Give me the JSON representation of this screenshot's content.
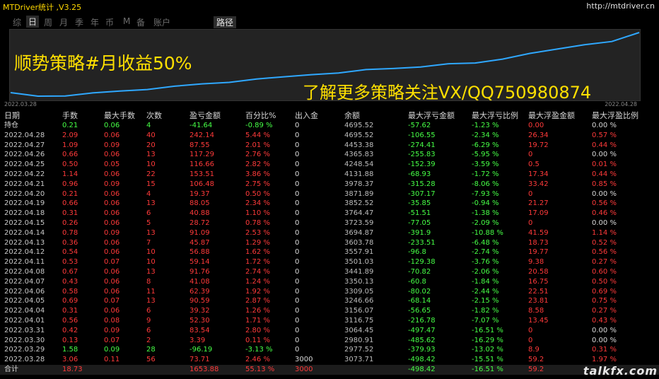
{
  "header": {
    "title": "MTDriver统计 ,V3.25",
    "url": "http://mtdriver.cn"
  },
  "tabs": [
    "综",
    "日",
    "周",
    "月",
    "季",
    "年",
    "币",
    "M",
    "备",
    "账户",
    "路径"
  ],
  "active_tab": "日",
  "chart": {
    "start_date": "2022.03.28",
    "end_date": "2022.04.28",
    "line_color": "#2fa8ff",
    "overlay_text_1": "顺势策略#月收益50%",
    "overlay_text_2": "了解更多策略关注VX/QQ750980874"
  },
  "chart_data": {
    "type": "line",
    "x": [
      "2022.03.28",
      "2022.03.29",
      "2022.03.30",
      "2022.03.31",
      "2022.04.01",
      "2022.04.04",
      "2022.04.05",
      "2022.04.06",
      "2022.04.07",
      "2022.04.08",
      "2022.04.11",
      "2022.04.12",
      "2022.04.13",
      "2022.04.14",
      "2022.04.15",
      "2022.04.18",
      "2022.04.19",
      "2022.04.20",
      "2022.04.21",
      "2022.04.22",
      "2022.04.25",
      "2022.04.26",
      "2022.04.27",
      "2022.04.28"
    ],
    "values": [
      3073.71,
      2977.52,
      2980.91,
      3064.45,
      3116.75,
      3156.07,
      3246.66,
      3309.05,
      3350.13,
      3441.89,
      3501.03,
      3557.91,
      3603.78,
      3694.87,
      3723.59,
      3764.47,
      3852.52,
      3871.89,
      3978.37,
      4131.88,
      4248.54,
      4365.83,
      4453.38,
      4695.52
    ]
  },
  "table": {
    "columns": [
      "日期",
      "手数",
      "最大手数",
      "次数",
      "盈亏金额",
      "百分比%",
      "出入金",
      "余额",
      "最大浮亏金额",
      "最大浮亏比例",
      "最大浮盈金额",
      "最大浮盈比例"
    ],
    "rows": [
      [
        "持仓",
        "0.21",
        "0.06",
        "4",
        "-41.64",
        "-0.89 %",
        "0",
        "4695.52",
        "-57.62",
        "-1.23 %",
        "0.00",
        "0.00 %"
      ],
      [
        "2022.04.28",
        "2.09",
        "0.06",
        "40",
        "242.14",
        "5.44 %",
        "0",
        "4695.52",
        "-106.55",
        "-2.34 %",
        "26.34",
        "0.57 %"
      ],
      [
        "2022.04.27",
        "1.09",
        "0.09",
        "20",
        "87.55",
        "2.01 %",
        "0",
        "4453.38",
        "-274.41",
        "-6.29 %",
        "19.72",
        "0.44 %"
      ],
      [
        "2022.04.26",
        "0.66",
        "0.06",
        "13",
        "117.29",
        "2.76 %",
        "0",
        "4365.83",
        "-255.83",
        "-5.95 %",
        "0",
        "0.00 %"
      ],
      [
        "2022.04.25",
        "0.50",
        "0.05",
        "10",
        "116.66",
        "2.82 %",
        "0",
        "4248.54",
        "-152.39",
        "-3.59 %",
        "0.5",
        "0.01 %"
      ],
      [
        "2022.04.22",
        "1.14",
        "0.06",
        "22",
        "153.51",
        "3.86 %",
        "0",
        "4131.88",
        "-68.93",
        "-1.72 %",
        "17.34",
        "0.44 %"
      ],
      [
        "2022.04.21",
        "0.96",
        "0.09",
        "15",
        "106.48",
        "2.75 %",
        "0",
        "3978.37",
        "-315.28",
        "-8.06 %",
        "33.42",
        "0.85 %"
      ],
      [
        "2022.04.20",
        "0.21",
        "0.06",
        "4",
        "19.37",
        "0.50 %",
        "0",
        "3871.89",
        "-307.17",
        "-7.93 %",
        "0",
        "0.00 %"
      ],
      [
        "2022.04.19",
        "0.66",
        "0.06",
        "13",
        "88.05",
        "2.34 %",
        "0",
        "3852.52",
        "-35.85",
        "-0.94 %",
        "21.27",
        "0.56 %"
      ],
      [
        "2022.04.18",
        "0.31",
        "0.06",
        "6",
        "40.88",
        "1.10 %",
        "0",
        "3764.47",
        "-51.51",
        "-1.38 %",
        "17.09",
        "0.46 %"
      ],
      [
        "2022.04.15",
        "0.26",
        "0.06",
        "5",
        "28.72",
        "0.78 %",
        "0",
        "3723.59",
        "-77.05",
        "-2.09 %",
        "0",
        "0.00 %"
      ],
      [
        "2022.04.14",
        "0.78",
        "0.09",
        "13",
        "91.09",
        "2.53 %",
        "0",
        "3694.87",
        "-391.9",
        "-10.88 %",
        "41.59",
        "1.14 %"
      ],
      [
        "2022.04.13",
        "0.36",
        "0.06",
        "7",
        "45.87",
        "1.29 %",
        "0",
        "3603.78",
        "-233.51",
        "-6.48 %",
        "18.73",
        "0.52 %"
      ],
      [
        "2022.04.12",
        "0.54",
        "0.06",
        "10",
        "56.88",
        "1.62 %",
        "0",
        "3557.91",
        "-96.8",
        "-2.74 %",
        "19.77",
        "0.56 %"
      ],
      [
        "2022.04.11",
        "0.53",
        "0.07",
        "10",
        "59.14",
        "1.72 %",
        "0",
        "3501.03",
        "-129.38",
        "-3.76 %",
        "9.38",
        "0.27 %"
      ],
      [
        "2022.04.08",
        "0.67",
        "0.06",
        "13",
        "91.76",
        "2.74 %",
        "0",
        "3441.89",
        "-70.82",
        "-2.06 %",
        "20.58",
        "0.60 %"
      ],
      [
        "2022.04.07",
        "0.43",
        "0.06",
        "8",
        "41.08",
        "1.24 %",
        "0",
        "3350.13",
        "-60.8",
        "-1.84 %",
        "16.75",
        "0.50 %"
      ],
      [
        "2022.04.06",
        "0.58",
        "0.06",
        "11",
        "62.39",
        "1.92 %",
        "0",
        "3309.05",
        "-80.02",
        "-2.44 %",
        "22.51",
        "0.69 %"
      ],
      [
        "2022.04.05",
        "0.69",
        "0.07",
        "13",
        "90.59",
        "2.87 %",
        "0",
        "3246.66",
        "-68.14",
        "-2.15 %",
        "23.81",
        "0.75 %"
      ],
      [
        "2022.04.04",
        "0.31",
        "0.06",
        "6",
        "39.32",
        "1.26 %",
        "0",
        "3156.07",
        "-56.65",
        "-1.82 %",
        "8.58",
        "0.27 %"
      ],
      [
        "2022.04.01",
        "0.56",
        "0.08",
        "9",
        "52.30",
        "1.71 %",
        "0",
        "3116.75",
        "-216.78",
        "-7.07 %",
        "13.45",
        "0.43 %"
      ],
      [
        "2022.03.31",
        "0.42",
        "0.09",
        "6",
        "83.54",
        "2.80 %",
        "0",
        "3064.45",
        "-497.47",
        "-16.51 %",
        "0",
        "0.00 %"
      ],
      [
        "2022.03.30",
        "0.13",
        "0.07",
        "2",
        "3.39",
        "0.11 %",
        "0",
        "2980.91",
        "-485.62",
        "-16.29 %",
        "0",
        "0.00 %"
      ],
      [
        "2022.03.29",
        "1.58",
        "0.09",
        "28",
        "-96.19",
        "-3.13 %",
        "0",
        "2977.52",
        "-379.93",
        "-13.02 %",
        "8.9",
        "0.31 %"
      ],
      [
        "2022.03.28",
        "3.06",
        "0.11",
        "56",
        "73.71",
        "2.46 %",
        "3000",
        "3073.71",
        "-498.42",
        "-15.51 %",
        "59.2",
        "1.97 %"
      ]
    ],
    "total": [
      "合计",
      "18.73",
      "",
      "",
      "1653.88",
      "55.13 %",
      "3000",
      "",
      "-498.42",
      "-16.51 %",
      "59.2",
      ""
    ]
  },
  "watermark": "talkfx.com",
  "colors": {
    "positive": "#ff3a3a",
    "negative": "#46ff46",
    "title": "#ffd800"
  }
}
